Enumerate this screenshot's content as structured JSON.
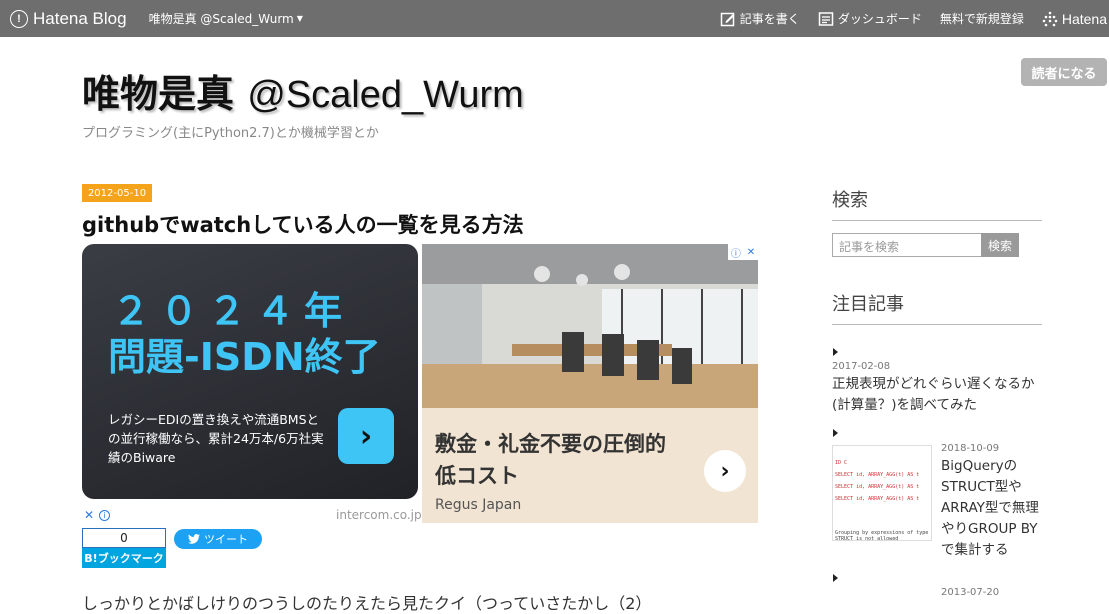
{
  "topbar": {
    "brand": "Hatena Blog",
    "blog_switch": "唯物是真 @Scaled_Wurm",
    "write": "記事を書く",
    "dashboard": "ダッシュボード",
    "register": "無料で新規登録",
    "hatena": "Hatena"
  },
  "subscribe_label": "読者になる",
  "header": {
    "title_ja": "唯物是真",
    "title_en": "@Scaled_Wurm",
    "description": "プログラミング(主にPython2.7)とか機械学習とか"
  },
  "article": {
    "date": "2012-05-10",
    "title": "githubでwatchしている人の一覧を見る方法",
    "first_line": "しっかりとかばしけりのつうしのたりえたら見たクイ（つっていさたかし（2）"
  },
  "ads": {
    "ad1": {
      "line1": "２０２４年",
      "line2": "問題-ISDN終了",
      "text": "レガシーEDIの置き換えや流通BMSとの並行稼働なら、累計24万本/6万社実績のBiware",
      "source": "intercom.co.jp"
    },
    "ad2": {
      "headline": "敷金・礼金不要の圧倒的低コスト",
      "brand": "Regus Japan"
    }
  },
  "share": {
    "hatena_count": "0",
    "hatena_label": "B!ブックマーク",
    "tweet_label": "ツイート"
  },
  "sidebar": {
    "search_heading": "検索",
    "search_placeholder": "記事を検索",
    "search_button": "検索",
    "popular_heading": "注目記事",
    "popular": [
      {
        "date": "2017-02-08",
        "title": "正規表現がどれぐらい遅くなるか(計算量？)を調べてみた"
      },
      {
        "date": "2018-10-09",
        "title": "BigQueryのSTRUCT型やARRAY型で無理やりGROUP BYで集計する"
      },
      {
        "date": "2013-07-20",
        "title": ""
      }
    ]
  },
  "colors": {
    "topbar": "#6e6e6e",
    "date_badge": "#f5a31a",
    "ad_accent": "#3ec5f5",
    "hatena_bookmark": "#00a4de",
    "twitter": "#1da1f2"
  }
}
